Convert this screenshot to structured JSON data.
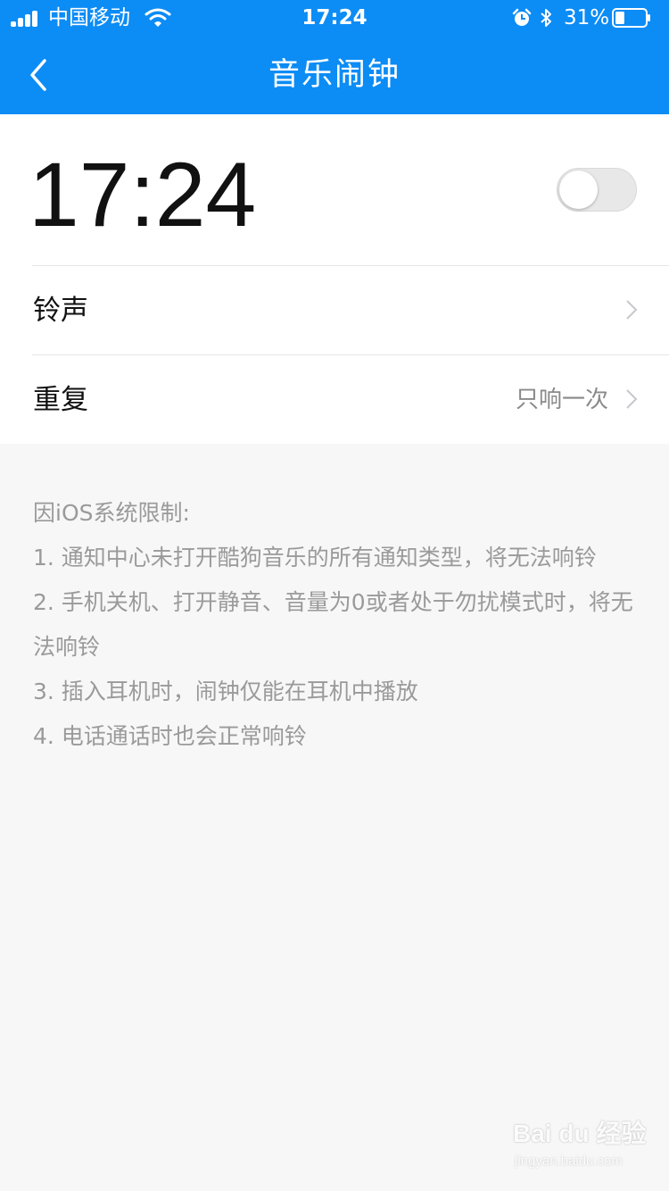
{
  "status_bar": {
    "carrier": "中国移动",
    "time": "17:24",
    "battery_percent": "31%",
    "battery_level": 0.31,
    "icons": [
      "signal-icon",
      "wifi-icon",
      "alarm-icon",
      "bluetooth-icon",
      "battery-icon"
    ]
  },
  "nav": {
    "title": "音乐闹钟",
    "back_icon": "chevron-left-icon"
  },
  "alarm": {
    "time": "17:24",
    "enabled": false
  },
  "settings": {
    "ringtone": {
      "label": "铃声",
      "value": ""
    },
    "repeat": {
      "label": "重复",
      "value": "只响一次"
    }
  },
  "notes": [
    "因iOS系统限制:",
    "1. 通知中心未打开酷狗音乐的所有通知类型，将无法响铃",
    "2. 手机关机、打开静音、音量为0或者处于勿扰模式时，将无法响铃",
    "3. 插入耳机时，闹钟仅能在耳机中播放",
    "4. 电话通话时也会正常响铃"
  ],
  "watermark": {
    "main": "Bai du 经验",
    "sub": "jingyan.baidu.com"
  },
  "colors": {
    "header": "#0c8cf5",
    "page_background": "#f7f7f7",
    "notes_text": "#9a9a9a"
  }
}
